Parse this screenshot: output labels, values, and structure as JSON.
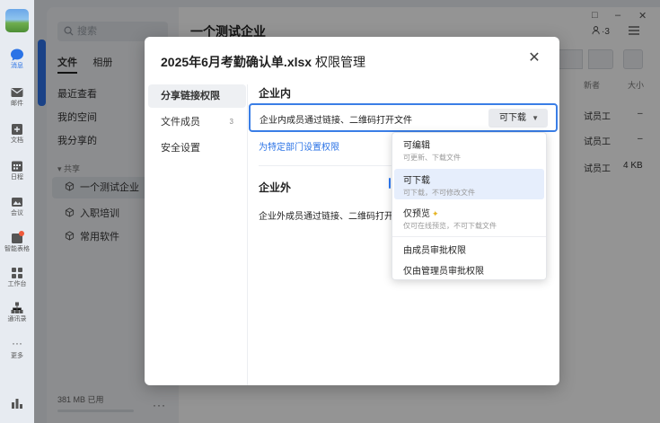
{
  "rail": {
    "items": [
      {
        "label": "消息",
        "icon": "message-icon"
      },
      {
        "label": "邮件",
        "icon": "mail-icon"
      },
      {
        "label": "文档",
        "icon": "document-icon"
      },
      {
        "label": "日程",
        "icon": "calendar-icon"
      },
      {
        "label": "会议",
        "icon": "meeting-icon"
      },
      {
        "label": "智能表格",
        "icon": "smart-sheet-icon"
      },
      {
        "label": "工作台",
        "icon": "workbench-icon"
      },
      {
        "label": "通讯录",
        "icon": "contacts-icon"
      },
      {
        "label": "更多",
        "icon": "more-icon"
      }
    ]
  },
  "panel": {
    "search_placeholder": "搜索",
    "tabs": [
      "文件",
      "相册"
    ],
    "nav": [
      "最近查看",
      "我的空间",
      "我分享的"
    ],
    "share_header": "共享",
    "share_items": [
      "一个测试企业",
      "入职培训",
      "常用软件"
    ],
    "storage": "381 MB 已用"
  },
  "main": {
    "title": "一个测试企业",
    "members": "3",
    "col_headers": [
      "新者",
      "大小"
    ],
    "rows": [
      {
        "owner": "试员工",
        "size": "–"
      },
      {
        "owner": "试员工",
        "size": "–"
      },
      {
        "owner": "试员工",
        "size": "4 KB"
      }
    ]
  },
  "dialog": {
    "title_file": "2025年6月考勤确认单.xlsx",
    "title_suffix": " 权限管理",
    "nav": [
      {
        "label": "分享链接权限",
        "count": ""
      },
      {
        "label": "文件成员",
        "count": "3"
      },
      {
        "label": "安全设置",
        "count": ""
      }
    ],
    "internal": {
      "header": "企业内",
      "link_text": "企业内成员通过链接、二维码打开文件",
      "perm_value": "可下载",
      "dept_link": "为特定部门设置权限"
    },
    "external": {
      "header": "企业外",
      "text": "企业外成员通过链接、二维码打开"
    }
  },
  "dropdown": {
    "options": [
      {
        "title": "可编辑",
        "desc": "可更新、下载文件"
      },
      {
        "title": "可下载",
        "desc": "可下载，不可修改文件"
      },
      {
        "title": "仅预览",
        "desc": "仅可在线预览，不可下载文件"
      }
    ],
    "extra": [
      "由成员审批权限",
      "仅由管理员审批权限"
    ]
  },
  "colors": {
    "accent": "#2b73e6",
    "overlay": "rgba(0,0,0,0.42)"
  }
}
